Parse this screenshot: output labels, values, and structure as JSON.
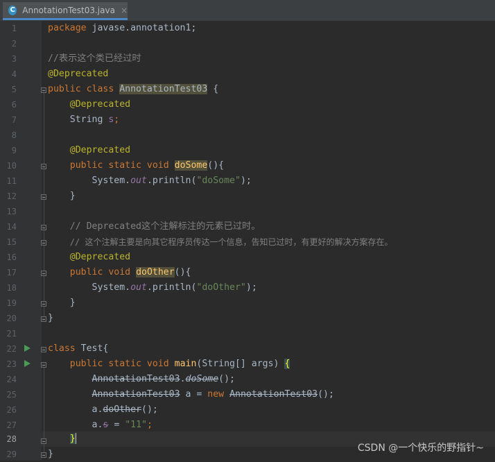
{
  "tab": {
    "icon_letter": "C",
    "title": "AnnotationTest03.java",
    "close": "×"
  },
  "line_numbers": [
    "1",
    "2",
    "3",
    "4",
    "5",
    "6",
    "7",
    "8",
    "9",
    "10",
    "11",
    "12",
    "13",
    "14",
    "15",
    "16",
    "17",
    "18",
    "19",
    "20",
    "21",
    "22",
    "23",
    "24",
    "25",
    "26",
    "27",
    "28",
    "29"
  ],
  "code": {
    "l1": {
      "kw": "package",
      "rest": " javase.annotation1;"
    },
    "l3": {
      "comment": "//表示这个类已经过时"
    },
    "l4": {
      "ann": "@Deprecated"
    },
    "l5": {
      "kw": "public class",
      "name": "AnnotationTest03",
      "rest": " {"
    },
    "l6": {
      "ann": "@Deprecated"
    },
    "l7": {
      "type": "String ",
      "field": "s",
      "end": ";"
    },
    "l9": {
      "ann": "@Deprecated"
    },
    "l10": {
      "kw": "public static void",
      "name": "doSome",
      "rest": "(){"
    },
    "l11": {
      "obj": "System.",
      "sfield": "out",
      "call": ".println(",
      "str": "\"doSome\"",
      "end": ");"
    },
    "l12": {
      "brace": "}"
    },
    "l14": {
      "comment": "// Deprecated这个注解标注的元素已过时。"
    },
    "l15": {
      "comment": "// 这个注解主要是向其它程序员传达一个信息，告知已过时，有更好的解决方案存在。"
    },
    "l16": {
      "ann": "@Deprecated"
    },
    "l17": {
      "kw": "public void",
      "name": "doOther",
      "rest": "(){"
    },
    "l18": {
      "obj": "System.",
      "sfield": "out",
      "call": ".println(",
      "str": "\"doOther\"",
      "end": ");"
    },
    "l19": {
      "brace": "}"
    },
    "l20": {
      "brace": "}"
    },
    "l22": {
      "kw": "class",
      "rest": " Test{"
    },
    "l23": {
      "kw": "public static void",
      "name": "main",
      "rest": "(String[] args) ",
      "brace": "{"
    },
    "l24": {
      "cls": "AnnotationTest03",
      "dot": ".",
      "method": "doSome",
      "end": "();"
    },
    "l25": {
      "cls": "AnnotationTest03",
      "mid": " a = ",
      "kw": "new",
      "cls2": "AnnotationTest03",
      "end": "();"
    },
    "l26": {
      "var": "a.",
      "method": "doOther",
      "end": "();"
    },
    "l27": {
      "var": "a.",
      "field": "s",
      "mid": " = ",
      "str": "\"11\"",
      "end": ";"
    },
    "l28": {
      "brace": "}"
    },
    "l29": {
      "brace": "}"
    }
  },
  "watermark": "CSDN @一个快乐的野指针~"
}
